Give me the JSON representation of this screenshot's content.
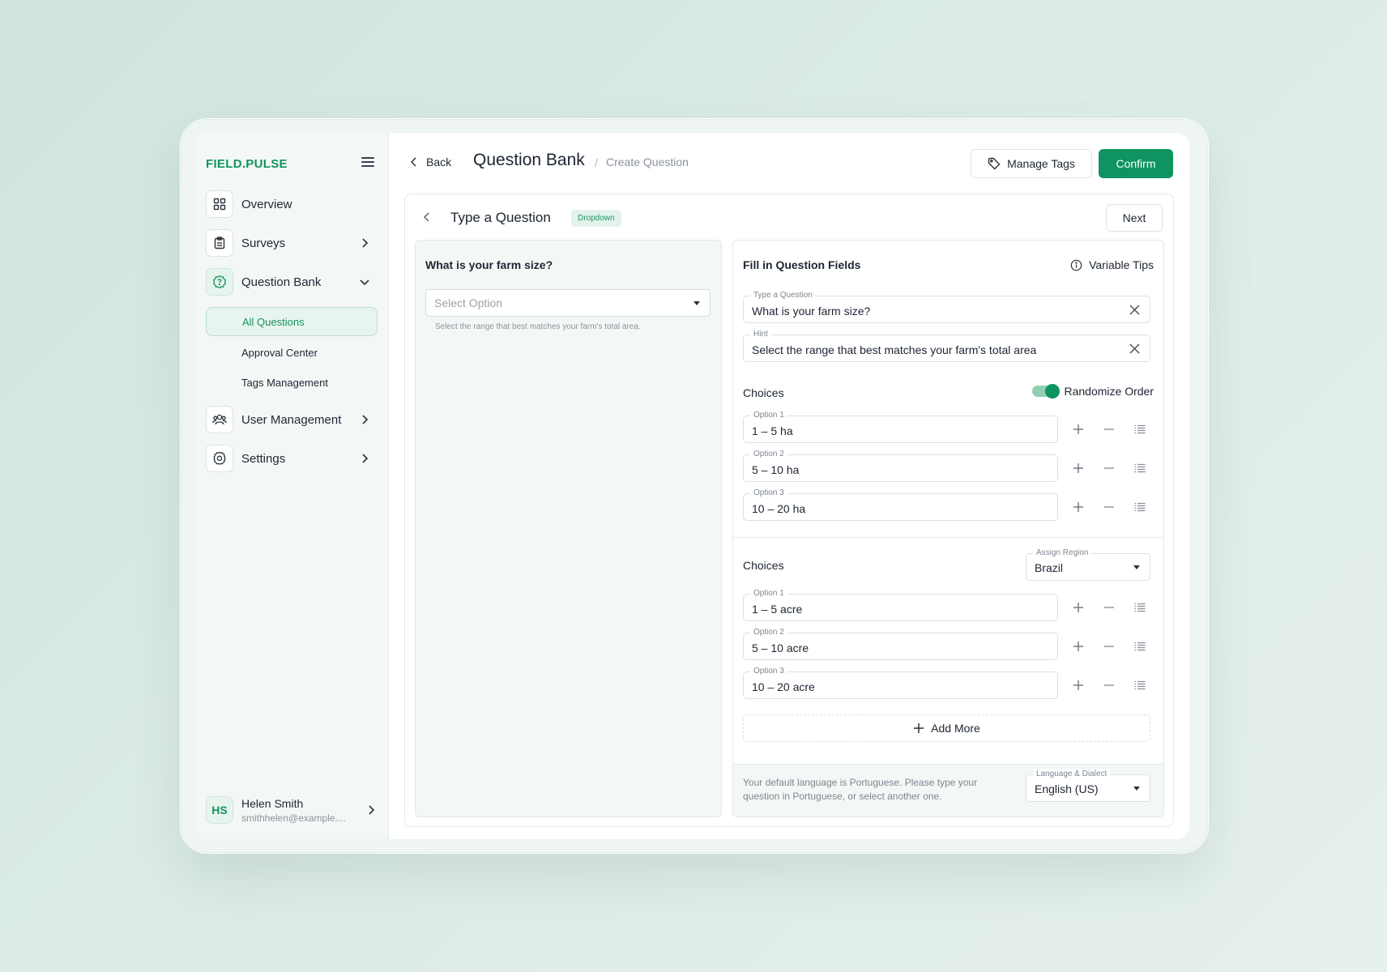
{
  "app": {
    "logo": "FIELD.PULSE"
  },
  "sidebar": {
    "items": [
      {
        "label": "Overview",
        "icon": "grid-icon"
      },
      {
        "label": "Surveys",
        "icon": "clipboard-icon"
      },
      {
        "label": "Question Bank",
        "icon": "question-gear-icon"
      },
      {
        "label": "User Management",
        "icon": "users-icon"
      },
      {
        "label": "Settings",
        "icon": "gear-icon"
      }
    ],
    "sub_items": [
      {
        "label": "All Questions",
        "active": true
      },
      {
        "label": "Approval Center"
      },
      {
        "label": "Tags Management"
      }
    ],
    "user": {
      "initials": "HS",
      "name": "Helen Smith",
      "email": "smithhelen@example...."
    }
  },
  "header": {
    "back_label": "Back",
    "title": "Question Bank",
    "separator": "/",
    "crumb": "Create Question",
    "manage_tags_label": "Manage Tags",
    "confirm_label": "Confirm"
  },
  "card": {
    "title": "Type a Question",
    "badge": "Dropdown",
    "next_label": "Next"
  },
  "preview": {
    "question": "What is your farm size?",
    "select_placeholder": "Select Option",
    "hint": "Select the range that best matches your farm's total area."
  },
  "fields": {
    "title": "Fill in Question Fields",
    "tips_label": "Variable Tips",
    "question_field": {
      "label": "Type a Question",
      "value": "What is your farm size?"
    },
    "hint_field": {
      "label": "Hint",
      "value": "Select the range that best matches your farm's total area"
    },
    "choices_label": "Choices",
    "randomize_label": "Randomize Order",
    "randomize_on": true,
    "options": [
      {
        "label": "Option 1",
        "value": "1 – 5 ha"
      },
      {
        "label": "Option 2",
        "value": "5 – 10 ha"
      },
      {
        "label": "Option 3",
        "value": "10 – 20 ha"
      }
    ],
    "regional_choices_label": "Choices",
    "region": {
      "label": "Assign Region",
      "value": "Brazil"
    },
    "regional_options": [
      {
        "label": "Option 1",
        "value": "1 – 5 acre"
      },
      {
        "label": "Option 2",
        "value": "5 – 10 acre"
      },
      {
        "label": "Option 3",
        "value": "10 – 20 acre"
      }
    ],
    "add_more_label": "Add More",
    "footer_text": "Your default language is Portuguese. Please type your question in Portuguese, or select another one.",
    "language": {
      "label": "Language & Dialect",
      "value": "English (US)"
    }
  },
  "colors": {
    "accent": "#0f9360",
    "sidebar_bg": "#f3f8f6"
  }
}
